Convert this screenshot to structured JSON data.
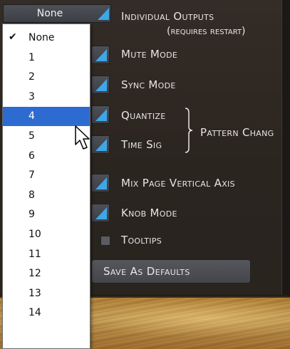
{
  "selector": {
    "value": "None",
    "arrow_icon": "triangle-corner-icon"
  },
  "options": {
    "individual_outputs": {
      "label": "Individual Outputs",
      "note": "(requires restart)"
    },
    "mute_mode": {
      "label": "Mute Mode"
    },
    "sync_mode": {
      "label": "Sync Mode"
    },
    "quantize": {
      "label": "Quantize"
    },
    "time_sig": {
      "label": "Time Sig"
    },
    "pattern_change": {
      "label": "Pattern Chang"
    },
    "mix_page_vertical_axis": {
      "label": "Mix Page Vertical Axis"
    },
    "knob_mode": {
      "label": "Knob Mode"
    },
    "tooltips": {
      "label": "Tooltips"
    }
  },
  "save_defaults": {
    "label": "Save As Defaults"
  },
  "dropdown": {
    "checked": "None",
    "highlighted": "4",
    "items": [
      "None",
      "1",
      "2",
      "3",
      "4",
      "5",
      "6",
      "7",
      "8",
      "9",
      "10",
      "11",
      "12",
      "13",
      "14"
    ]
  },
  "colors": {
    "accent": "#3fa6e8",
    "highlight": "#2e6bd1",
    "panel": "#2e2823"
  }
}
